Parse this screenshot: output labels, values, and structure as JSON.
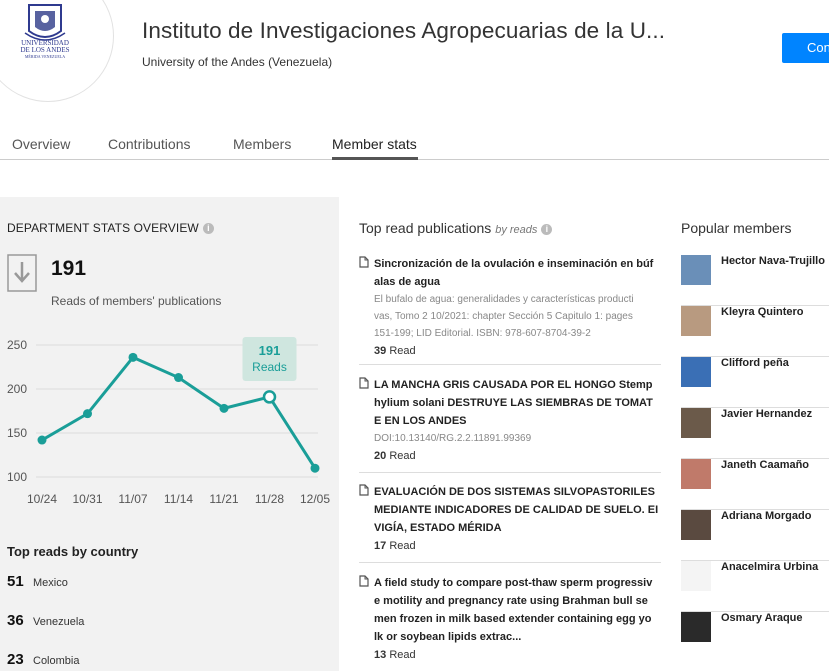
{
  "header": {
    "logo_lines": [
      "UNIVERSIDAD",
      "DE LOS ANDES",
      "MÉRIDA VENEZUELA"
    ],
    "title": "Instituto de Investigaciones Agropecuarias de la U...",
    "subtitle": "University of the Andes (Venezuela)",
    "connect_label": "Connect"
  },
  "tabs": [
    {
      "label": "Overview",
      "active": false
    },
    {
      "label": "Contributions",
      "active": false
    },
    {
      "label": "Members",
      "active": false
    },
    {
      "label": "Member stats",
      "active": true
    }
  ],
  "stats": {
    "heading": "DEPARTMENT STATS OVERVIEW",
    "total": "191",
    "total_label": "Reads of members' publications",
    "tooltip_value": "191",
    "tooltip_label": "Reads"
  },
  "chart_data": {
    "type": "line",
    "x": [
      "10/24",
      "10/31",
      "11/07",
      "11/14",
      "11/21",
      "11/28",
      "12/05"
    ],
    "values": [
      142,
      172,
      236,
      213,
      178,
      191,
      110
    ],
    "highlighted_index": 5,
    "ylim": [
      100,
      250
    ],
    "yticks": [
      "100",
      "150",
      "200",
      "250"
    ],
    "grid": true,
    "color": "#1a9e98"
  },
  "countries": {
    "heading": "Top reads by country",
    "items": [
      {
        "count": "51",
        "name": "Mexico"
      },
      {
        "count": "36",
        "name": "Venezuela"
      },
      {
        "count": "23",
        "name": "Colombia"
      }
    ]
  },
  "publications": {
    "heading": "Top read publications",
    "heading_suffix": "by reads",
    "read_word": "Read",
    "items": [
      {
        "title_lines": [
          "Sincronización de la ovulación e inseminación en búf",
          "alas de agua"
        ],
        "meta_lines": [
          "El bufalo de agua: generalidades y características producti",
          "vas, Tomo 2 10/2021: chapter Sección 5 Capitulo 1: pages",
          "151-199; LID Editorial. ISBN: 978-607-8704-39-2"
        ],
        "reads": "39"
      },
      {
        "title_lines": [
          "LA MANCHA GRIS CAUSADA POR EL HONGO Stemp",
          "hylium solani DESTRUYE LAS SIEMBRAS DE TOMAT",
          "E EN LOS ANDES"
        ],
        "meta_lines": [
          "DOI:10.13140/RG.2.2.11891.99369"
        ],
        "reads": "20"
      },
      {
        "title_lines": [
          "EVALUACIÓN DE DOS SISTEMAS SILVOPASTORILES",
          "MEDIANTE INDICADORES DE CALIDAD DE SUELO. EI",
          "VIGÍA, ESTADO MÉRIDA"
        ],
        "meta_lines": [],
        "reads": "17"
      },
      {
        "title_lines": [
          "A field study to compare post-thaw sperm progressiv",
          "e motility and pregnancy rate using Brahman bull se",
          "men frozen in milk based extender containing egg yo",
          "lk or soybean lipids extrac..."
        ],
        "meta_lines": [],
        "reads": "13"
      }
    ]
  },
  "members": {
    "heading": "Popular members",
    "items": [
      {
        "name": "Hector Nava-Trujillo",
        "avatar_color": "#6a8fb8"
      },
      {
        "name": "Kleyra Quintero",
        "avatar_color": "#b89a80"
      },
      {
        "name": "Clifford peña",
        "avatar_color": "#3a6fb5"
      },
      {
        "name": "Javier Hernandez",
        "avatar_color": "#6b5a4a"
      },
      {
        "name": "Janeth Caamaño",
        "avatar_color": "#c07a6a"
      },
      {
        "name": "Adriana Morgado",
        "avatar_color": "#5a4a40"
      },
      {
        "name": "Anacelmira Urbina",
        "avatar_color": "#f4f4f4"
      },
      {
        "name": "Osmary Araque",
        "avatar_color": "#2a2a2a"
      }
    ]
  }
}
